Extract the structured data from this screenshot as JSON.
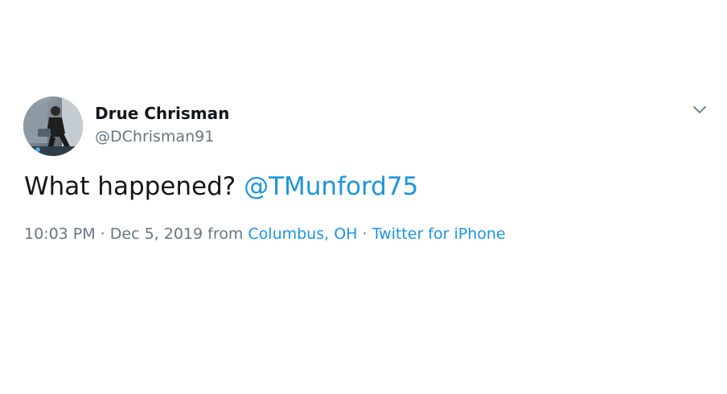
{
  "author": {
    "display_name": "Drue Chrisman",
    "handle": "@DChrisman91",
    "avatar_icon": "profile-photo"
  },
  "tweet": {
    "text": "What happened? ",
    "mention": "@TMunford75"
  },
  "meta": {
    "time": "10:03 PM",
    "separator1": " · ",
    "date": "Dec 5, 2019",
    "from_label": " from ",
    "location": "Columbus, OH",
    "separator2": " · ",
    "source": "Twitter for iPhone"
  },
  "menu": {
    "icon": "chevron-down-icon"
  },
  "colors": {
    "link": "#1b95e0",
    "text": "#14171a",
    "secondary": "#657786"
  }
}
